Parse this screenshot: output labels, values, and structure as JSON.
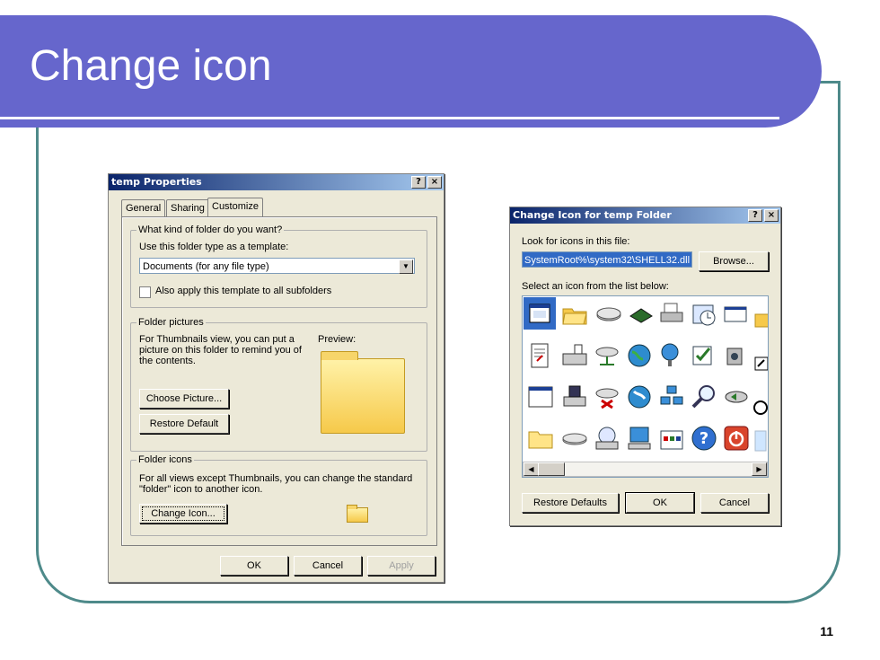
{
  "slide": {
    "title": "Change icon",
    "page_number": "11"
  },
  "props": {
    "title": "temp Properties",
    "help_btn": "?",
    "close_btn": "×",
    "tabs": [
      "General",
      "Sharing",
      "Customize"
    ],
    "group1": {
      "label": "What kind of folder do you want?",
      "template_label": "Use this folder type as a template:",
      "template_value": "Documents (for any file type)",
      "apply_sub": "Also apply this template to all subfolders"
    },
    "group2": {
      "label": "Folder pictures",
      "desc1": "For Thumbnails view, you can put a",
      "desc2": "picture on this folder to remind you of",
      "desc3": "the contents.",
      "preview": "Preview:",
      "choose_btn": "Choose Picture...",
      "restore_btn": "Restore Default"
    },
    "group3": {
      "label": "Folder icons",
      "desc1": "For all views except Thumbnails, you can change the standard",
      "desc2": "\"folder\" icon to another icon.",
      "change_btn": "Change Icon..."
    },
    "ok": "OK",
    "cancel": "Cancel",
    "apply": "Apply"
  },
  "changeicon": {
    "title": "Change Icon for temp Folder",
    "help_btn": "?",
    "close_btn": "×",
    "look_label": "Look for icons in this file:",
    "file_value": "SystemRoot%\\system32\\SHELL32.dll",
    "browse": "Browse...",
    "select_label": "Select an icon from the list below:",
    "restore": "Restore Defaults",
    "ok": "OK",
    "cancel": "Cancel"
  },
  "colors": {
    "title_band": "#6666cc",
    "frame": "#4e8a8a",
    "selection": "#316ac5"
  }
}
